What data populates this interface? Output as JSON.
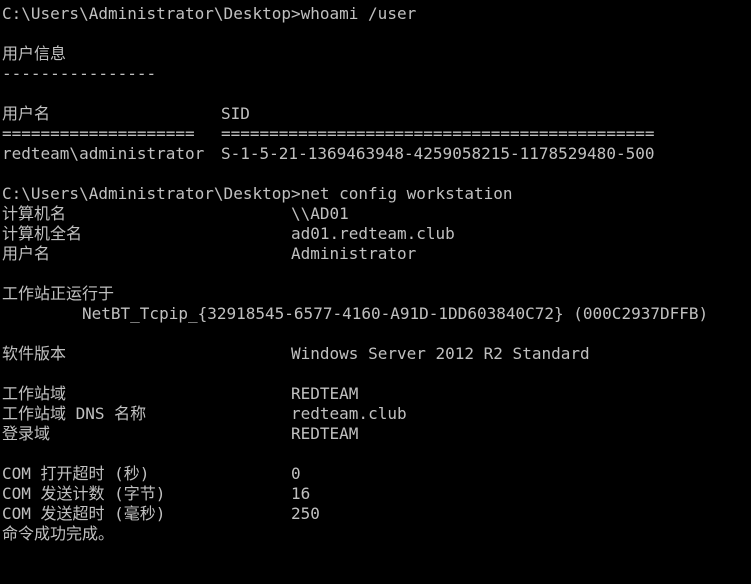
{
  "prompt1": "C:\\Users\\Administrator\\Desktop>whoami /user",
  "user_info_title": "用户信息",
  "user_info_rule": "----------------",
  "user_table": {
    "col_user_header": "用户名",
    "col_sid_header": "SID",
    "col_user_rule": "====================",
    "col_sid_rule": "=============================================",
    "user_value": "redteam\\administrator",
    "sid_value": "S-1-5-21-1369463948-4259058215-1178529480-500"
  },
  "prompt2": "C:\\Users\\Administrator\\Desktop>net config workstation",
  "config": {
    "computer_name_label": "计算机名",
    "computer_name_value": "\\\\AD01",
    "full_computer_name_label": "计算机全名",
    "full_computer_name_value": "ad01.redteam.club",
    "user_name_label": "用户名",
    "user_name_value": "Administrator",
    "running_on_label": "工作站正运行于",
    "running_on_value": "NetBT_Tcpip_{32918545-6577-4160-A91D-1DD603840C72} (000C2937DFFB)",
    "software_version_label": "软件版本",
    "software_version_value": "Windows Server 2012 R2 Standard",
    "workstation_domain_label": "工作站域",
    "workstation_domain_value": "REDTEAM",
    "workstation_dns_label": "工作站域 DNS 名称",
    "workstation_dns_value": "redteam.club",
    "logon_domain_label": "登录域",
    "logon_domain_value": "REDTEAM",
    "com_open_timeout_label": "COM 打开超时 (秒)",
    "com_open_timeout_value": "0",
    "com_send_count_label": "COM 发送计数 (字节)",
    "com_send_count_value": "16",
    "com_send_timeout_label": "COM 发送超时 (毫秒)",
    "com_send_timeout_value": "250",
    "completed_message": "命令成功完成。"
  }
}
